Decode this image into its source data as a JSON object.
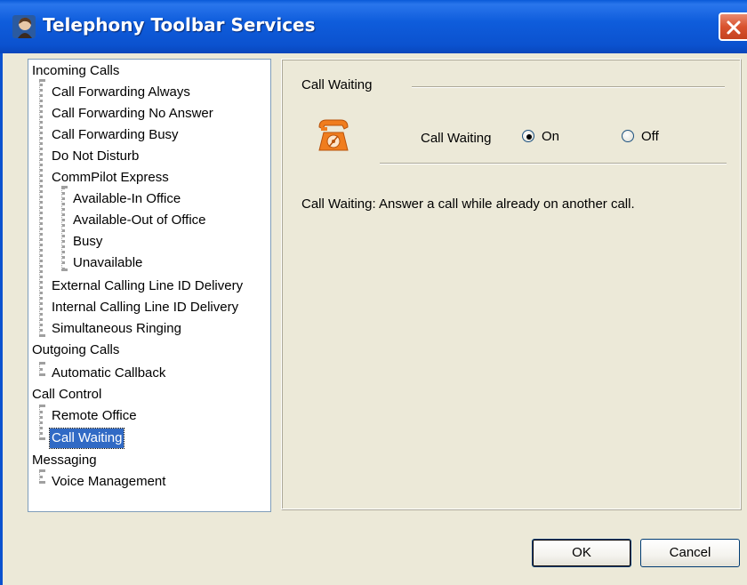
{
  "window": {
    "title": "Telephony Toolbar Services"
  },
  "tree": {
    "items": [
      "Incoming Calls",
      "Call Forwarding Always",
      "Call Forwarding No Answer",
      "Call Forwarding Busy",
      "Do Not Disturb",
      "CommPilot Express",
      "Available-In Office",
      "Available-Out of Office",
      "Busy",
      "Unavailable",
      "External Calling Line ID Delivery",
      "Internal Calling Line ID Delivery",
      "Simultaneous Ringing",
      "Outgoing Calls",
      "Automatic Callback",
      "Call Control",
      "Remote Office",
      "Call Waiting",
      "Messaging",
      "Voice Management"
    ],
    "selected": "Call Waiting"
  },
  "panel": {
    "group_title": "Call Waiting",
    "setting_label": "Call Waiting",
    "option_on": "On",
    "option_off": "Off",
    "selected_option": "On",
    "description": "Call Waiting: Answer a call while already on another call."
  },
  "buttons": {
    "ok": "OK",
    "cancel": "Cancel"
  },
  "colors": {
    "titlebar": "#0b52cf",
    "selection": "#316ac5",
    "phone_icon": "#f07d1e"
  }
}
